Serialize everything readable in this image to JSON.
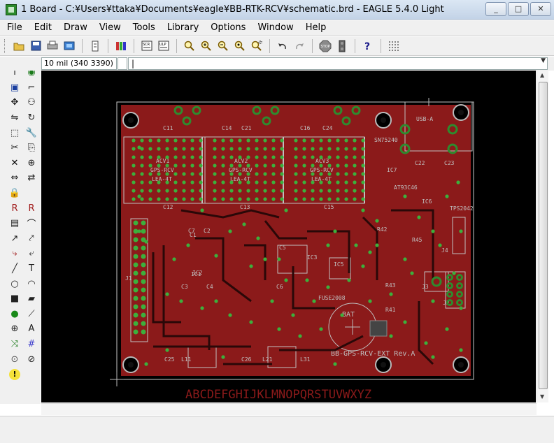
{
  "window": {
    "title": "1 Board - C:¥Users¥ttaka¥Documents¥eagle¥BB-RTK-RCV¥schematic.brd - EAGLE 5.4.0 Light",
    "minimize": "_",
    "maximize": "□",
    "close": "✕"
  },
  "menu": [
    "File",
    "Edit",
    "Draw",
    "View",
    "Tools",
    "Library",
    "Options",
    "Window",
    "Help"
  ],
  "toolbar": {
    "groups": [
      [
        "open-icon",
        "save-icon",
        "print-icon",
        "cam-icon"
      ],
      [
        "board-switch-icon"
      ],
      [
        "library-icon"
      ],
      [
        "script-icon",
        "ulp-icon"
      ],
      [
        "zoom-fit-icon",
        "zoom-in-icon",
        "zoom-out-icon",
        "zoom-redraw-icon",
        "zoom-select-icon"
      ],
      [
        "undo-icon",
        "redo-icon"
      ],
      [
        "stop-icon",
        "go-icon"
      ],
      [
        "help-icon"
      ],
      [
        "grid-icon"
      ]
    ]
  },
  "command": {
    "coordinates": "10 mil (340 3390)",
    "input": "|"
  },
  "palette": [
    "info-icon",
    "show-icon",
    "display-icon",
    "mark-icon",
    "move-icon",
    "copy-icon",
    "mirror-icon",
    "rotate-icon",
    "group-icon",
    "change-icon",
    "cut-icon",
    "paste-icon",
    "delete-icon",
    "add-icon",
    "pinswap-icon",
    "replace-icon",
    "lock-icon",
    "",
    "name-icon",
    "value-icon",
    "smash-icon",
    "miter-icon",
    "split-icon",
    "optimize-icon",
    "route-icon",
    "ripup-icon",
    "wire-icon",
    "text-icon",
    "circle-icon",
    "arc-icon",
    "rect-icon",
    "polygon-icon",
    "via-icon",
    "signal-icon",
    "hole-icon",
    "attribute-icon",
    "ratsnest-icon",
    "auto-icon",
    "erc-icon",
    "drc-icon",
    "errors-icon",
    ""
  ],
  "board": {
    "footer_text": "ABCDEFGHIJKLMNOPQRSTUVWXYZ",
    "silkscreen": [
      "ACV1",
      "GPS-RCV",
      "LEA-4T",
      "ACV2",
      "GPS-RCV",
      "LEA-4T",
      "ACV3",
      "GPS-RCV",
      "LEA-4T",
      "USB-A",
      "SN75240",
      "BAT",
      "BB-GPS-RCV-EXT  Rev.A",
      "IC1",
      "IC2",
      "IC3",
      "IC5",
      "IC6",
      "IC7",
      "J1",
      "J2",
      "J3",
      "J4",
      "C1",
      "C2",
      "C3",
      "C4",
      "C5",
      "C6",
      "C7",
      "C11",
      "C12",
      "C13",
      "C14",
      "C15",
      "C16",
      "C21",
      "C22",
      "C23",
      "C24",
      "C25",
      "C26",
      "L11",
      "L21",
      "L31",
      "R41",
      "R42",
      "R43",
      "R45",
      "FUSE2008",
      "TPS2042",
      "AT93C46"
    ]
  },
  "colors": {
    "board_fill": "#8b1a1a",
    "silkscreen": "#c0c0c0",
    "pads": "#2e8b2e",
    "vias": "#3cb03c",
    "canvas_bg": "#000000",
    "frame": "#c8c8c8"
  }
}
